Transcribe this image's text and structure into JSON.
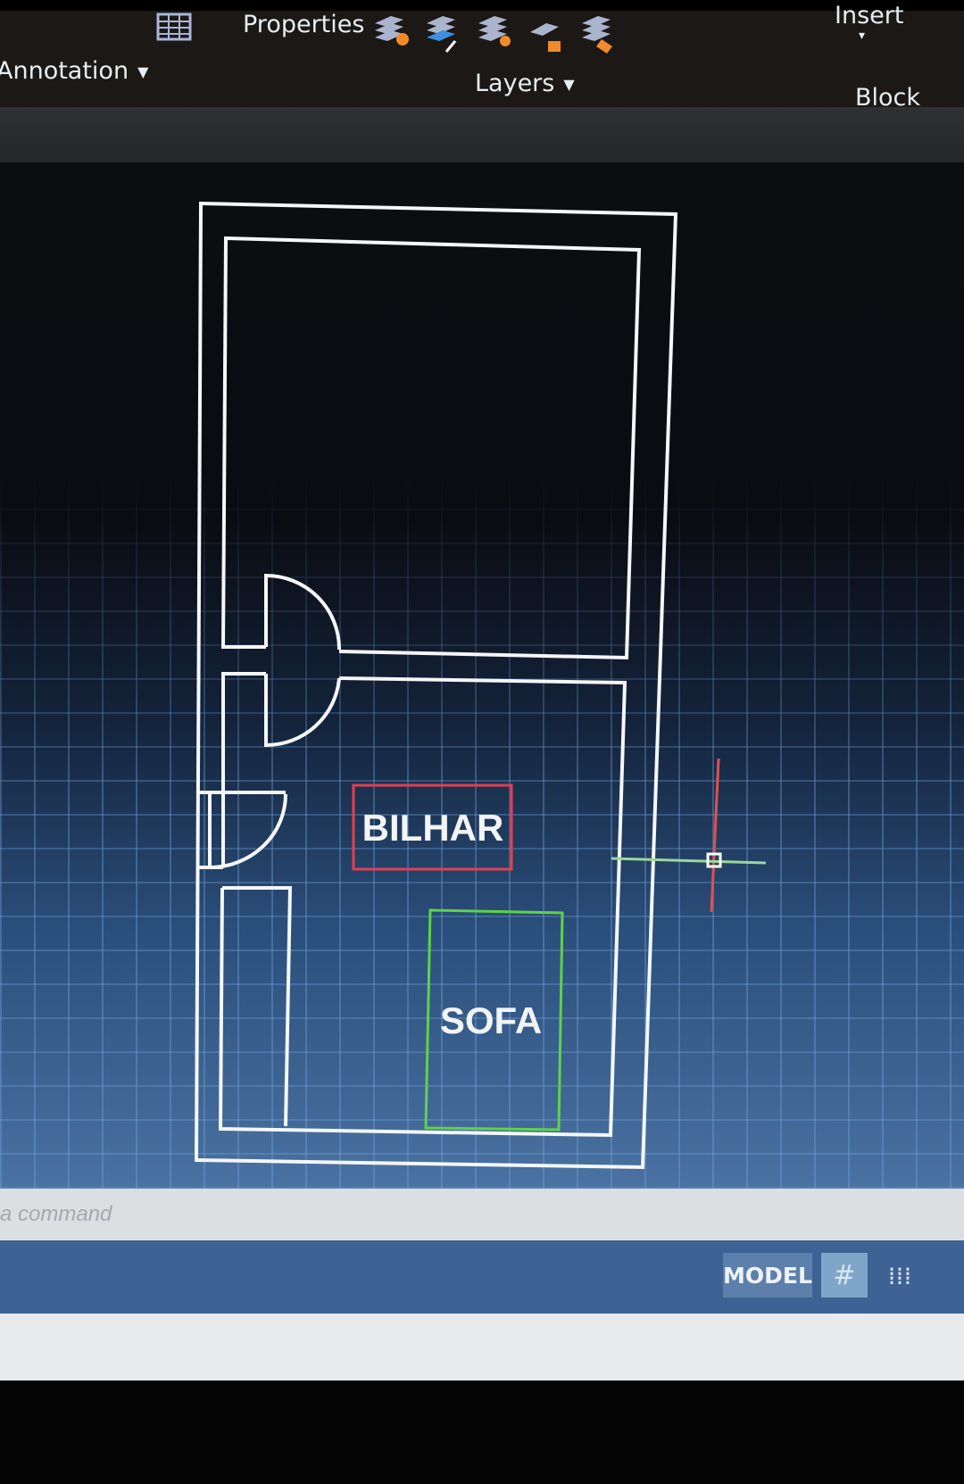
{
  "ribbon": {
    "properties_label": "Properties",
    "annotation_label": "Annotation",
    "layers_label": "Layers",
    "insert_label": "Insert",
    "block_label": "Block",
    "icons": [
      "table-icon",
      "layer-properties-icon",
      "layer-match-icon",
      "layer-isolate-icon",
      "layer-lock-icon",
      "layer-freeze-icon"
    ]
  },
  "drawing": {
    "rooms": [
      {
        "label": "BILHAR",
        "color": "#e0404f"
      },
      {
        "label": "SOFA",
        "color": "#5fd24a"
      }
    ],
    "wall_color": "#ffffff",
    "crosshair_x_color": "#e05050",
    "crosshair_y_color": "#8fd08a"
  },
  "command_line": {
    "placeholder": "a command"
  },
  "status_bar": {
    "model_label": "MODEL",
    "grid_icon": "grid-icon",
    "snap_icon": "snap-icon"
  }
}
